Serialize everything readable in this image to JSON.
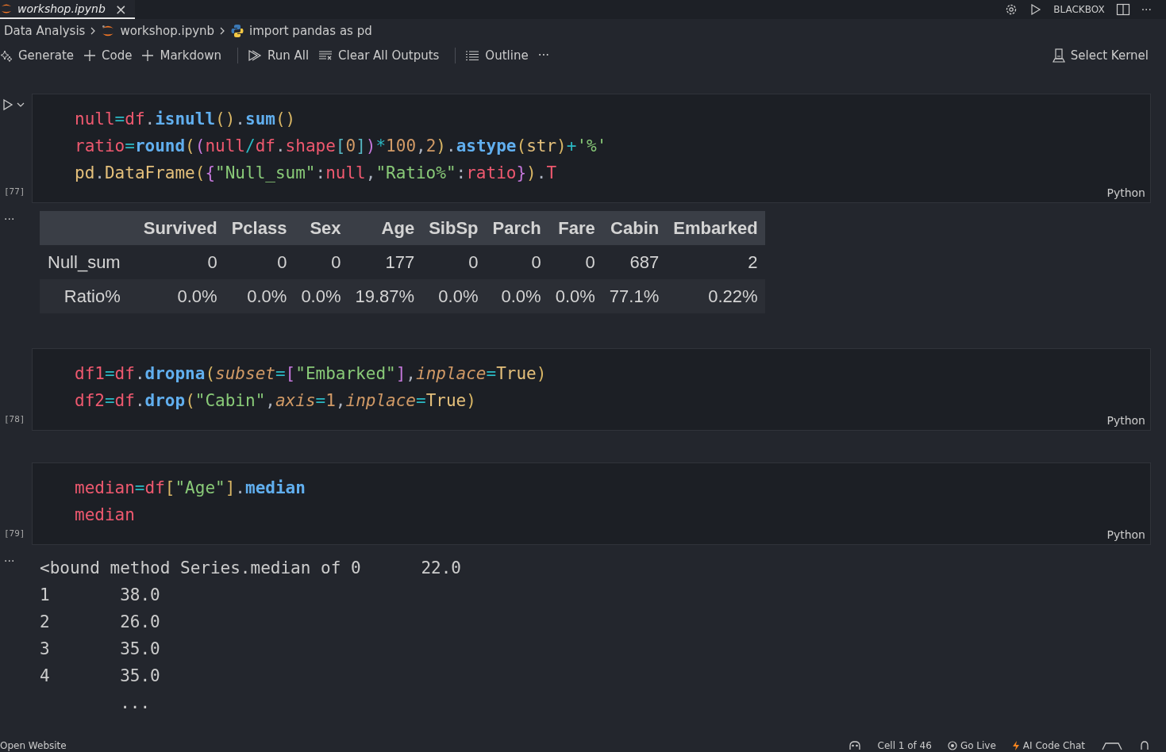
{
  "tab": {
    "title": "workshop.ipynb",
    "close": "×"
  },
  "top_actions": {
    "label": "BLACKBOX",
    "more": "···"
  },
  "breadcrumb": [
    "Data Analysis",
    "workshop.ipynb",
    "import pandas as pd"
  ],
  "toolbar": [
    {
      "kind": "generate",
      "label": "Generate"
    },
    {
      "kind": "plus",
      "label": "Code"
    },
    {
      "kind": "plus",
      "label": "Markdown"
    },
    {
      "kind": "sep"
    },
    {
      "kind": "run",
      "label": "Run All"
    },
    {
      "kind": "clear",
      "label": "Clear All Outputs"
    },
    {
      "kind": "sep"
    },
    {
      "kind": "outline",
      "label": "Outline"
    },
    {
      "kind": "more",
      "label": "···"
    }
  ],
  "kernel": "Select Kernel",
  "cells": [
    {
      "count": "[77]",
      "language": "Python",
      "focused": true,
      "lines": [
        [
          {
            "kind": "var",
            "text": "null"
          },
          {
            "kind": "op",
            "text": "="
          },
          {
            "kind": "var",
            "text": "df"
          },
          {
            "kind": "punct",
            "text": "."
          },
          {
            "kind": "fn",
            "text": "isnull"
          },
          {
            "kind": "br1",
            "text": "()"
          },
          {
            "kind": "punct",
            "text": "."
          },
          {
            "kind": "fn",
            "text": "sum"
          },
          {
            "kind": "br1",
            "text": "()"
          }
        ],
        [
          {
            "kind": "var",
            "text": "ratio"
          },
          {
            "kind": "op",
            "text": "="
          },
          {
            "kind": "fn",
            "text": "round"
          },
          {
            "kind": "br1",
            "text": "("
          },
          {
            "kind": "br2",
            "text": "("
          },
          {
            "kind": "var",
            "text": "null"
          },
          {
            "kind": "op",
            "text": "/"
          },
          {
            "kind": "var",
            "text": "df"
          },
          {
            "kind": "punct",
            "text": "."
          },
          {
            "kind": "var",
            "text": "shape"
          },
          {
            "kind": "br3",
            "text": "["
          },
          {
            "kind": "num",
            "text": "0"
          },
          {
            "kind": "br3",
            "text": "]"
          },
          {
            "kind": "br2",
            "text": ")"
          },
          {
            "kind": "op",
            "text": "*"
          },
          {
            "kind": "num",
            "text": "100"
          },
          {
            "kind": "punct",
            "text": ","
          },
          {
            "kind": "num",
            "text": "2"
          },
          {
            "kind": "br1",
            "text": ")"
          },
          {
            "kind": "punct",
            "text": "."
          },
          {
            "kind": "fn",
            "text": "astype"
          },
          {
            "kind": "br1",
            "text": "("
          },
          {
            "kind": "cls",
            "text": "str"
          },
          {
            "kind": "br1",
            "text": ")"
          },
          {
            "kind": "op",
            "text": "+"
          },
          {
            "kind": "str",
            "text": "'%'"
          }
        ],
        [
          {
            "kind": "cls",
            "text": "pd"
          },
          {
            "kind": "punct",
            "text": "."
          },
          {
            "kind": "cls",
            "text": "DataFrame"
          },
          {
            "kind": "br1",
            "text": "("
          },
          {
            "kind": "br2",
            "text": "{"
          },
          {
            "kind": "str",
            "text": "\"Null_sum\""
          },
          {
            "kind": "punct",
            "text": ":"
          },
          {
            "kind": "var",
            "text": "null"
          },
          {
            "kind": "punct",
            "text": ","
          },
          {
            "kind": "str",
            "text": "\"Ratio%\""
          },
          {
            "kind": "punct",
            "text": ":"
          },
          {
            "kind": "var",
            "text": "ratio"
          },
          {
            "kind": "br2",
            "text": "}"
          },
          {
            "kind": "br1",
            "text": ")"
          },
          {
            "kind": "punct",
            "text": "."
          },
          {
            "kind": "var",
            "text": "T"
          }
        ]
      ],
      "output": {
        "kind": "table",
        "menu": "···",
        "columns": [
          "Survived",
          "Pclass",
          "Sex",
          "Age",
          "SibSp",
          "Parch",
          "Fare",
          "Cabin",
          "Embarked"
        ],
        "rows": [
          {
            "index": "Null_sum",
            "values": [
              "0",
              "0",
              "0",
              "177",
              "0",
              "0",
              "0",
              "687",
              "2"
            ]
          },
          {
            "index": "Ratio%",
            "values": [
              "0.0%",
              "0.0%",
              "0.0%",
              "19.87%",
              "0.0%",
              "0.0%",
              "0.0%",
              "77.1%",
              "0.22%"
            ]
          }
        ]
      }
    },
    {
      "count": "[78]",
      "language": "Python",
      "focused": false,
      "lines": [
        [
          {
            "kind": "var",
            "text": "df1"
          },
          {
            "kind": "op",
            "text": "="
          },
          {
            "kind": "var",
            "text": "df"
          },
          {
            "kind": "punct",
            "text": "."
          },
          {
            "kind": "fn",
            "text": "dropna"
          },
          {
            "kind": "br1",
            "text": "("
          },
          {
            "kind": "param",
            "text": "subset"
          },
          {
            "kind": "op",
            "text": "="
          },
          {
            "kind": "br2",
            "text": "["
          },
          {
            "kind": "str",
            "text": "\"Embarked\""
          },
          {
            "kind": "br2",
            "text": "]"
          },
          {
            "kind": "punct",
            "text": ","
          },
          {
            "kind": "param",
            "text": "inplace"
          },
          {
            "kind": "op",
            "text": "="
          },
          {
            "kind": "const",
            "text": "True"
          },
          {
            "kind": "br1",
            "text": ")"
          }
        ],
        [
          {
            "kind": "var",
            "text": "df2"
          },
          {
            "kind": "op",
            "text": "="
          },
          {
            "kind": "var",
            "text": "df"
          },
          {
            "kind": "punct",
            "text": "."
          },
          {
            "kind": "fn",
            "text": "drop"
          },
          {
            "kind": "br1",
            "text": "("
          },
          {
            "kind": "str",
            "text": "\"Cabin\""
          },
          {
            "kind": "punct",
            "text": ","
          },
          {
            "kind": "param",
            "text": "axis"
          },
          {
            "kind": "op",
            "text": "="
          },
          {
            "kind": "num",
            "text": "1"
          },
          {
            "kind": "punct",
            "text": ","
          },
          {
            "kind": "param",
            "text": "inplace"
          },
          {
            "kind": "op",
            "text": "="
          },
          {
            "kind": "const",
            "text": "True"
          },
          {
            "kind": "br1",
            "text": ")"
          }
        ]
      ]
    },
    {
      "count": "[79]",
      "language": "Python",
      "focused": false,
      "lines": [
        [
          {
            "kind": "var",
            "text": "median"
          },
          {
            "kind": "op",
            "text": "="
          },
          {
            "kind": "var",
            "text": "df"
          },
          {
            "kind": "br1",
            "text": "["
          },
          {
            "kind": "str",
            "text": "\"Age\""
          },
          {
            "kind": "br1",
            "text": "]"
          },
          {
            "kind": "punct",
            "text": "."
          },
          {
            "kind": "fn",
            "text": "median"
          }
        ],
        [
          {
            "kind": "var",
            "text": "median"
          }
        ]
      ],
      "output": {
        "kind": "text",
        "menu": "···",
        "lines": [
          "<bound method Series.median of 0      22.0",
          "1       38.0",
          "2       26.0",
          "3       35.0",
          "4       35.0",
          "        ..."
        ]
      }
    }
  ],
  "status_bar": {
    "left": "Open Website",
    "right": [
      {
        "kind": "copilot"
      },
      {
        "kind": "text",
        "label": "Cell 1 of 46"
      },
      {
        "kind": "live",
        "label": "Go Live"
      },
      {
        "kind": "ai",
        "label": "AI Code Chat"
      },
      {
        "kind": "ext"
      },
      {
        "kind": "bell"
      }
    ]
  }
}
